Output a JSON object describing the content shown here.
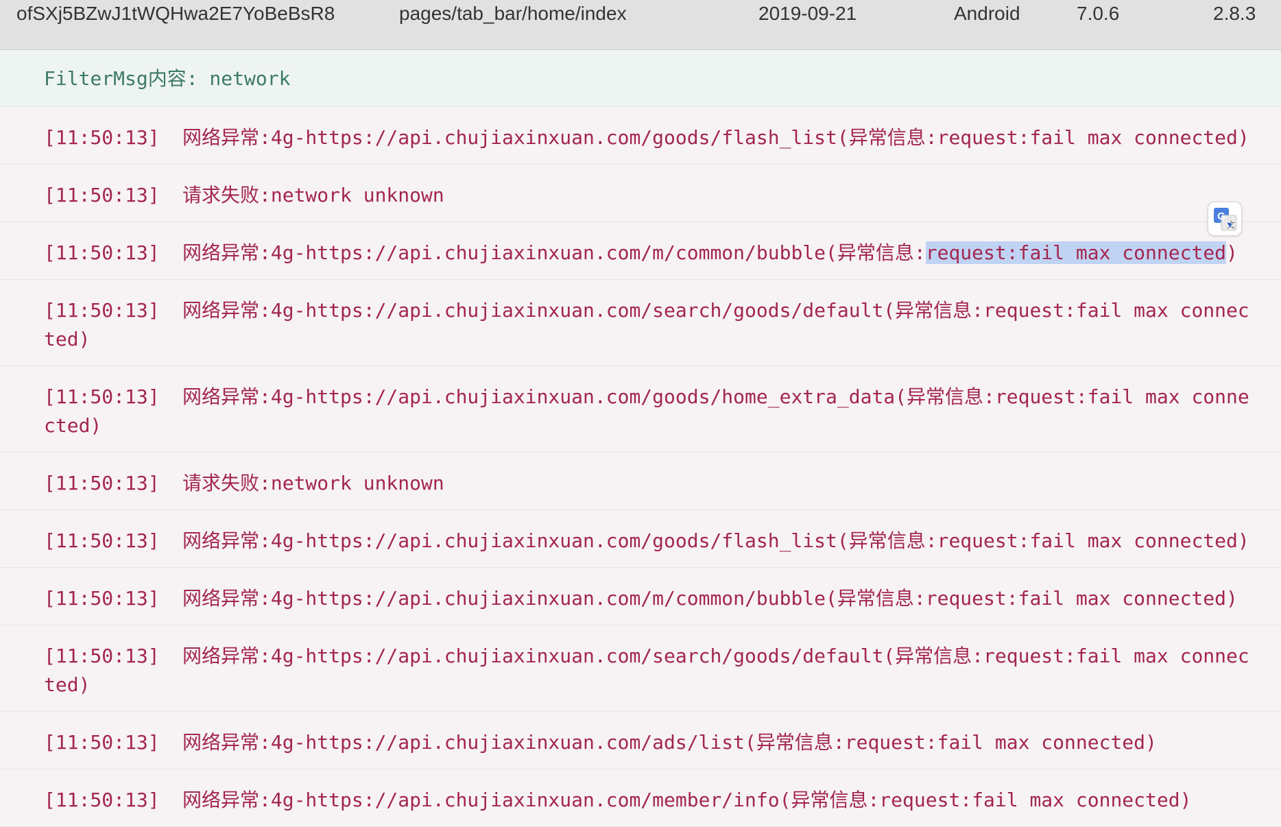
{
  "header": {
    "openid": "ofSXj5BZwJ1tWQHwa2E7YoBeBsR8",
    "page": "pages/tab_bar/home/index",
    "date": "2019-09-21",
    "os": "Android",
    "wechat_version": "7.0.6",
    "sdk_version": "2.8.3"
  },
  "filter": {
    "text": "FilterMsg内容: network"
  },
  "logs": [
    {
      "time": "[11:50:13]",
      "msg": "网络异常:4g-https://api.chujiaxinxuan.com/goods/flash_list(异常信息:request:fail max connected)"
    },
    {
      "time": "[11:50:13]",
      "msg": "请求失败:network unknown"
    },
    {
      "time": "[11:50:13]",
      "msg_before": "网络异常:4g-https://api.chujiaxinxuan.com/m/common/bubble(异常信息:",
      "msg_highlight": "request:fail max connected",
      "msg_after": ")"
    },
    {
      "time": "[11:50:13]",
      "msg": "网络异常:4g-https://api.chujiaxinxuan.com/search/goods/default(异常信息:request:fail max connected)"
    },
    {
      "time": "[11:50:13]",
      "msg": "网络异常:4g-https://api.chujiaxinxuan.com/goods/home_extra_data(异常信息:request:fail max connected)"
    },
    {
      "time": "[11:50:13]",
      "msg": "请求失败:network unknown"
    },
    {
      "time": "[11:50:13]",
      "msg": "网络异常:4g-https://api.chujiaxinxuan.com/goods/flash_list(异常信息:request:fail max connected)"
    },
    {
      "time": "[11:50:13]",
      "msg": "网络异常:4g-https://api.chujiaxinxuan.com/m/common/bubble(异常信息:request:fail max connected)"
    },
    {
      "time": "[11:50:13]",
      "msg": "网络异常:4g-https://api.chujiaxinxuan.com/search/goods/default(异常信息:request:fail max connected)"
    },
    {
      "time": "[11:50:13]",
      "msg": "网络异常:4g-https://api.chujiaxinxuan.com/ads/list(异常信息:request:fail max connected)"
    },
    {
      "time": "[11:50:13]",
      "msg": "网络异常:4g-https://api.chujiaxinxuan.com/member/info(异常信息:request:fail max connected)"
    }
  ],
  "translate_icon": "google-translate-icon",
  "colors": {
    "log_text": "#a3264f",
    "filter_text": "#3d7a66",
    "highlight": "#c1d3f3"
  }
}
